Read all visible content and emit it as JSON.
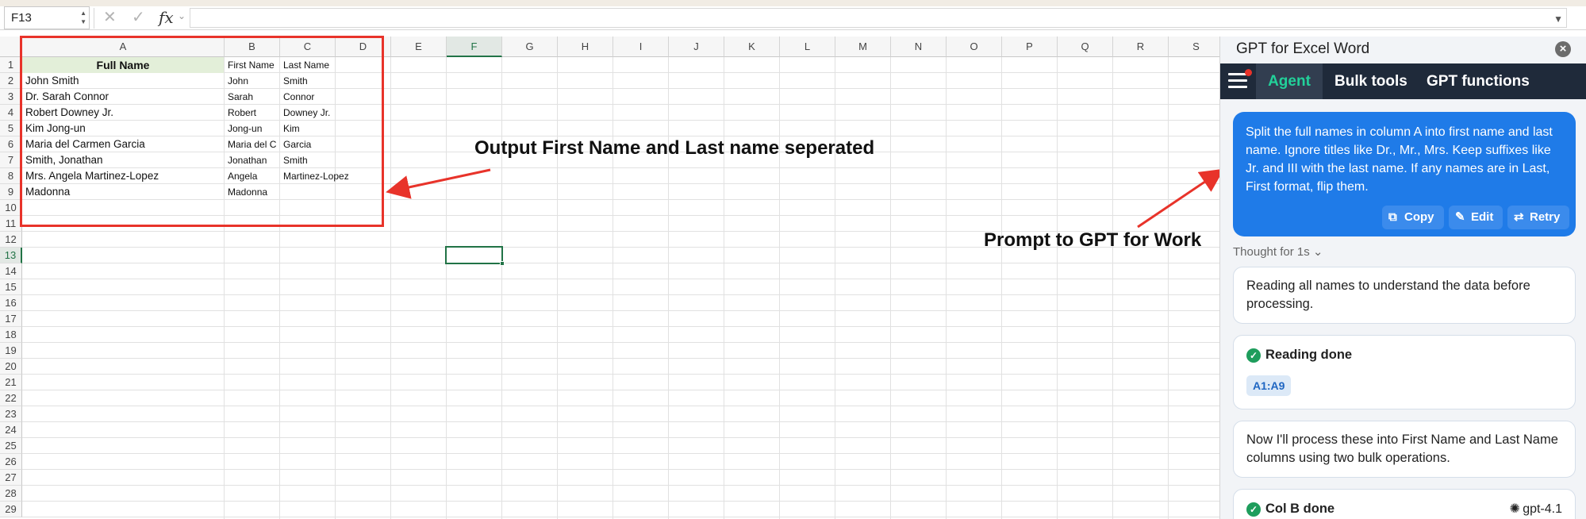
{
  "formula_bar": {
    "cell_ref": "F13",
    "cancel_icon": "close-icon",
    "confirm_icon": "check-icon",
    "fx_label": "fx",
    "formula": ""
  },
  "sheet": {
    "columns": [
      "A",
      "B",
      "C",
      "D",
      "E",
      "F",
      "G",
      "H",
      "I",
      "J",
      "K",
      "L",
      "M",
      "N",
      "O",
      "P",
      "Q",
      "R",
      "S"
    ],
    "active_column": "F",
    "rows": [
      "1",
      "2",
      "3",
      "4",
      "5",
      "6",
      "7",
      "8",
      "9",
      "10",
      "11",
      "12",
      "13",
      "14",
      "15",
      "16",
      "17",
      "18",
      "19",
      "20",
      "21",
      "22",
      "23",
      "24",
      "25",
      "26",
      "27",
      "28",
      "29"
    ],
    "active_row": "13",
    "selected_cell": "F13",
    "header_a": "Full Name",
    "header_b": "First Name",
    "header_c": "Last Name",
    "data": [
      {
        "full": "John Smith",
        "first": "John",
        "last": "Smith"
      },
      {
        "full": "Dr. Sarah Connor",
        "first": "Sarah",
        "last": "Connor"
      },
      {
        "full": "Robert Downey Jr.",
        "first": "Robert",
        "last": "Downey Jr."
      },
      {
        "full": "Kim Jong-un",
        "first": "Jong-un",
        "last": "Kim"
      },
      {
        "full": "Maria del Carmen Garcia",
        "first": "Maria del C",
        "last": "Garcia"
      },
      {
        "full": "Smith, Jonathan",
        "first": "Jonathan",
        "last": "Smith"
      },
      {
        "full": "Mrs. Angela Martinez-Lopez",
        "first": "Angela",
        "last": "Martinez-Lopez"
      },
      {
        "full": "Madonna",
        "first": "Madonna",
        "last": ""
      }
    ]
  },
  "annotations": {
    "output_label": "Output First Name and Last name seperated",
    "prompt_label": "Prompt to GPT for Work",
    "color": "#e8332a"
  },
  "panel": {
    "title": "GPT for Excel Word",
    "close_icon": "close-icon",
    "menu_icon": "hamburger-icon",
    "tabs": [
      "Agent",
      "Bulk tools",
      "GPT functions"
    ],
    "active_tab": "Agent",
    "prompt": "Split the full names in column A into first name and last name. Ignore titles like Dr., Mr., Mrs. Keep suffixes like Jr. and III with the last name. If any names are in Last, First format, flip them.",
    "prompt_actions": [
      "Copy",
      "Edit",
      "Retry"
    ],
    "thought_label": "Thought for 1s",
    "messages": {
      "reading_note": "Reading all names to understand the data before processing.",
      "reading_done": "Reading done",
      "reading_range": "A1:A9",
      "process_note": "Now I'll process these into First Name and Last Name columns using two bulk operations.",
      "col_b_done": "Col B done",
      "model": "gpt-4.1"
    },
    "colors": {
      "accent_tab": "#22d19a",
      "tab_bar": "#1f2a3a",
      "bubble": "#1f7be8",
      "success": "#1e9d5c"
    }
  }
}
